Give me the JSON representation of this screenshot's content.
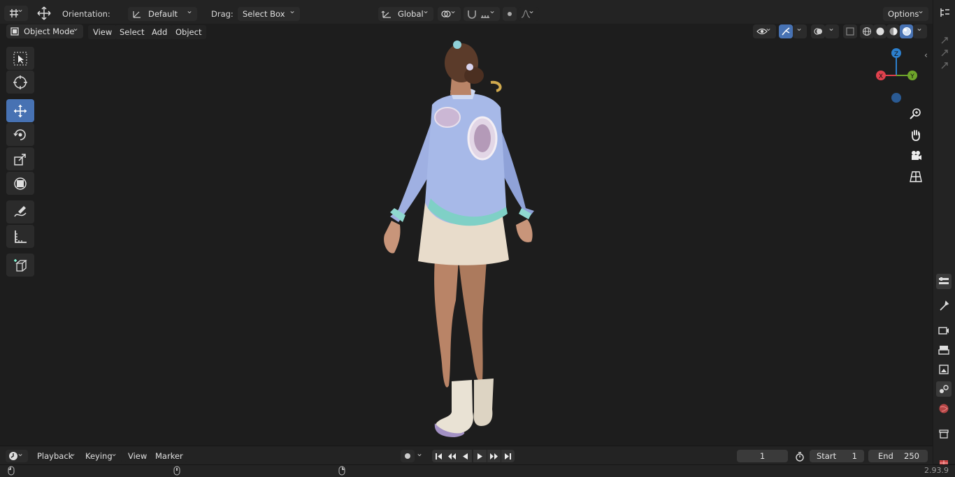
{
  "header": {
    "orientation_label": "Orientation:",
    "orientation_value": "Default",
    "drag_label": "Drag:",
    "drag_value": "Select Box",
    "transform_orientation": "Global",
    "options_label": "Options"
  },
  "viewport_header": {
    "mode": "Object Mode",
    "menus": [
      "View",
      "Select",
      "Add",
      "Object"
    ]
  },
  "gizmo": {
    "z": "Z",
    "y": "Y",
    "x": "X"
  },
  "timeline": {
    "editor_menus": [
      "Playback",
      "Keying",
      "View",
      "Marker"
    ],
    "current_frame": "1",
    "start_label": "Start",
    "start_value": "1",
    "end_label": "End",
    "end_value": "250"
  },
  "status": {
    "version": "2.93.9"
  },
  "icons": {
    "toolbar": [
      "select-box-icon",
      "cursor-icon",
      "move-icon",
      "rotate-icon",
      "scale-icon",
      "transform-icon",
      "annotate-icon",
      "measure-icon",
      "add-cube-icon"
    ],
    "nav": [
      "zoom-icon",
      "hand-pan-icon",
      "camera-icon",
      "grid-view-icon"
    ],
    "properties": [
      "tool-icon",
      "render-icon",
      "output-icon",
      "view-layer-icon",
      "scene-icon",
      "world-icon",
      "collection-icon"
    ]
  },
  "colors": {
    "accent": "#4772b3",
    "axis_x": "#e0414d",
    "axis_y": "#6ea52a",
    "axis_z": "#2c7fcd"
  }
}
